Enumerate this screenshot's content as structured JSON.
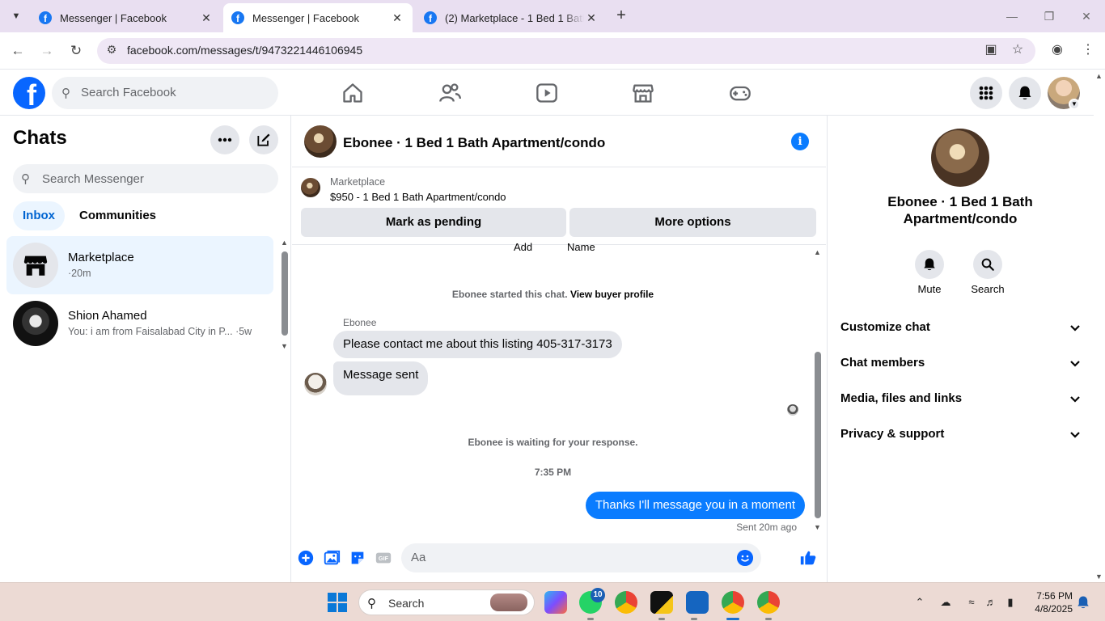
{
  "browser": {
    "tabs": [
      {
        "title": "Messenger | Facebook",
        "active": false
      },
      {
        "title": "Messenger | Facebook",
        "active": true
      },
      {
        "title": "(2) Marketplace - 1 Bed 1 Bath Apartment",
        "active": false
      }
    ],
    "url": "facebook.com/messages/t/9473221446106945"
  },
  "fb_nav": {
    "search_placeholder": "Search Facebook"
  },
  "chats": {
    "title": "Chats",
    "search_placeholder": "Search Messenger",
    "tabs": [
      "Inbox",
      "Communities"
    ],
    "items": [
      {
        "name": "Marketplace",
        "preview": "·20m",
        "selected": true
      },
      {
        "name": "Shion Ahamed",
        "preview": "You: i am from Faisalabad City in P...",
        "time": "·5w",
        "selected": false
      }
    ]
  },
  "conversation": {
    "title": "Ebonee · 1 Bed 1 Bath Apartment/condo",
    "marketplace_label": "Marketplace",
    "listing": "$950 - 1 Bed 1 Bath Apartment/condo",
    "buttons": [
      "Mark as pending",
      "More options"
    ],
    "cut_labels": [
      "Add",
      "Name"
    ],
    "started_text": "Ebonee started this chat.",
    "view_profile": "View buyer profile",
    "sender": "Ebonee",
    "messages_in": [
      "Please contact me about this listing 405-317-3173",
      "Message sent"
    ],
    "waiting_text": "Ebonee is waiting for your response.",
    "timestamp": "7:35 PM",
    "message_out": "Thanks I'll message you in a moment",
    "sent_status": "Sent 20m ago",
    "composer_placeholder": "Aa"
  },
  "info_panel": {
    "name": "Ebonee · 1 Bed 1 Bath Apartment/condo",
    "actions": [
      "Mute",
      "Search"
    ],
    "sections": [
      "Customize chat",
      "Chat members",
      "Media, files and links",
      "Privacy & support"
    ]
  },
  "taskbar": {
    "search_label": "Search",
    "whatsapp_badge": "10",
    "time": "7:56 PM",
    "date": "4/8/2025"
  },
  "colors": {
    "facebook_blue": "#0866ff",
    "messenger_blue": "#0a7cff",
    "taskbar_bg": "#ecdad4",
    "tabbar_bg": "#e9dff1"
  }
}
